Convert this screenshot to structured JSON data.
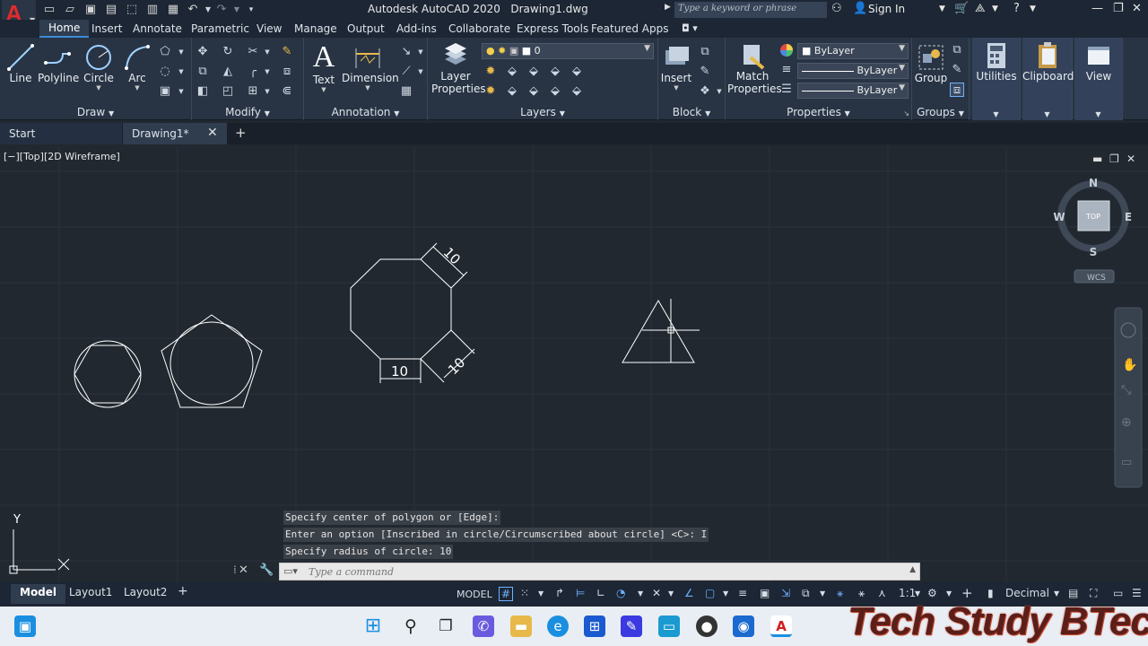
{
  "window": {
    "app_title": "Autodesk AutoCAD 2020",
    "file_title": "Drawing1.dwg",
    "search_placeholder": "Type a keyword or phrase",
    "signin": "Sign In"
  },
  "ribbon_tabs": [
    "Home",
    "Insert",
    "Annotate",
    "Parametric",
    "View",
    "Manage",
    "Output",
    "Add-ins",
    "Collaborate",
    "Express Tools",
    "Featured Apps"
  ],
  "ribbon": {
    "draw": {
      "title": "Draw",
      "line": "Line",
      "polyline": "Polyline",
      "circle": "Circle",
      "arc": "Arc"
    },
    "modify": {
      "title": "Modify"
    },
    "annotation": {
      "title": "Annotation",
      "text": "Text",
      "dimension": "Dimension"
    },
    "layers": {
      "title": "Layers",
      "layer_properties_1": "Layer",
      "layer_properties_2": "Properties",
      "current_layer": "0"
    },
    "block": {
      "title": "Block",
      "insert": "Insert"
    },
    "properties": {
      "title": "Properties",
      "match_1": "Match",
      "match_2": "Properties",
      "color": "ByLayer",
      "linetype": "ByLayer",
      "lineweight": "ByLayer"
    },
    "groups": {
      "title": "Groups",
      "group": "Group"
    },
    "utilities": {
      "label": "Utilities"
    },
    "clipboard": {
      "label": "Clipboard"
    },
    "view": {
      "label": "View"
    }
  },
  "file_tabs": {
    "start": "Start",
    "drawing": "Drawing1*"
  },
  "viewport": {
    "label": "[−][Top][2D Wireframe]",
    "viewcube": {
      "n": "N",
      "s": "S",
      "e": "E",
      "w": "W",
      "top": "TOP",
      "wcs": "WCS"
    },
    "dims": {
      "top_edge": "10",
      "bottom_edge": "10",
      "side_edge": "10"
    },
    "ucs": {
      "y": "Y",
      "x": "X"
    }
  },
  "command": {
    "history": [
      "Specify center of polygon or [Edge]:",
      "Enter an option [Inscribed in circle/Circumscribed about circle] <C>: I",
      "Specify radius of circle: 10"
    ],
    "placeholder": "Type a command"
  },
  "status": {
    "layouts": [
      "Model",
      "Layout1",
      "Layout2"
    ],
    "model": "MODEL",
    "scale": "1:1",
    "units": "Decimal"
  },
  "watermark": "Tech Study BTech",
  "colors": {
    "accent": "#3f8bd6",
    "canvas": "#212830",
    "ribbon": "#283444"
  }
}
